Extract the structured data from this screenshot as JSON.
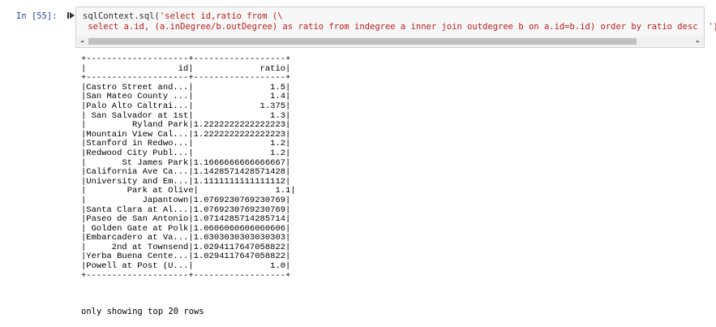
{
  "cell": {
    "prompt": "In [55]:",
    "run_icon": "step-forward-icon",
    "code_line1_prefix": "sqlContext.sql(",
    "code_line1_string": "'select id,ratio from (\\",
    "code_line2": " select a.id, (a.inDegree/b.outDegree) as ratio from indegree a inner join outdegree b on a.id=b.id) order by ratio desc  ').",
    "scroll_left": "◄",
    "scroll_right": "►"
  },
  "output": {
    "border": "+--------------------+------------------+",
    "header": "|                  id|             ratio|",
    "rows": [
      "|Castro Street and...|               1.5|",
      "|San Mateo County ...|               1.4|",
      "|Palo Alto Caltrai...|             1.375|",
      "| San Salvador at 1st|               1.3|",
      "|         Ryland Park|1.2222222222222223|",
      "|Mountain View Cal...|1.2222222222222223|",
      "|Stanford in Redwo...|               1.2|",
      "|Redwood City Publ...|               1.2|",
      "|       St James Park|1.1666666666666667|",
      "|California Ave Ca...|1.1428571428571428|",
      "|University and Em...|1.1111111111111112|",
      "|        Park at Olive|               1.1|",
      "|           Japantown|1.0769230769230769|",
      "|Santa Clara at Al...|1.0769230769230769|",
      "|Paseo de San Antonio|1.0714285714285714|",
      "| Golden Gate at Polk|1.0606060606060606|",
      "|Embarcadero at Va...|1.0303030303030303|",
      "|     2nd at Townsend|1.0294117647058822|",
      "|Yerba Buena Cente...|1.0294117647058822|",
      "|Powell at Post (U...|               1.0|"
    ],
    "footer": "only showing top 20 rows"
  }
}
